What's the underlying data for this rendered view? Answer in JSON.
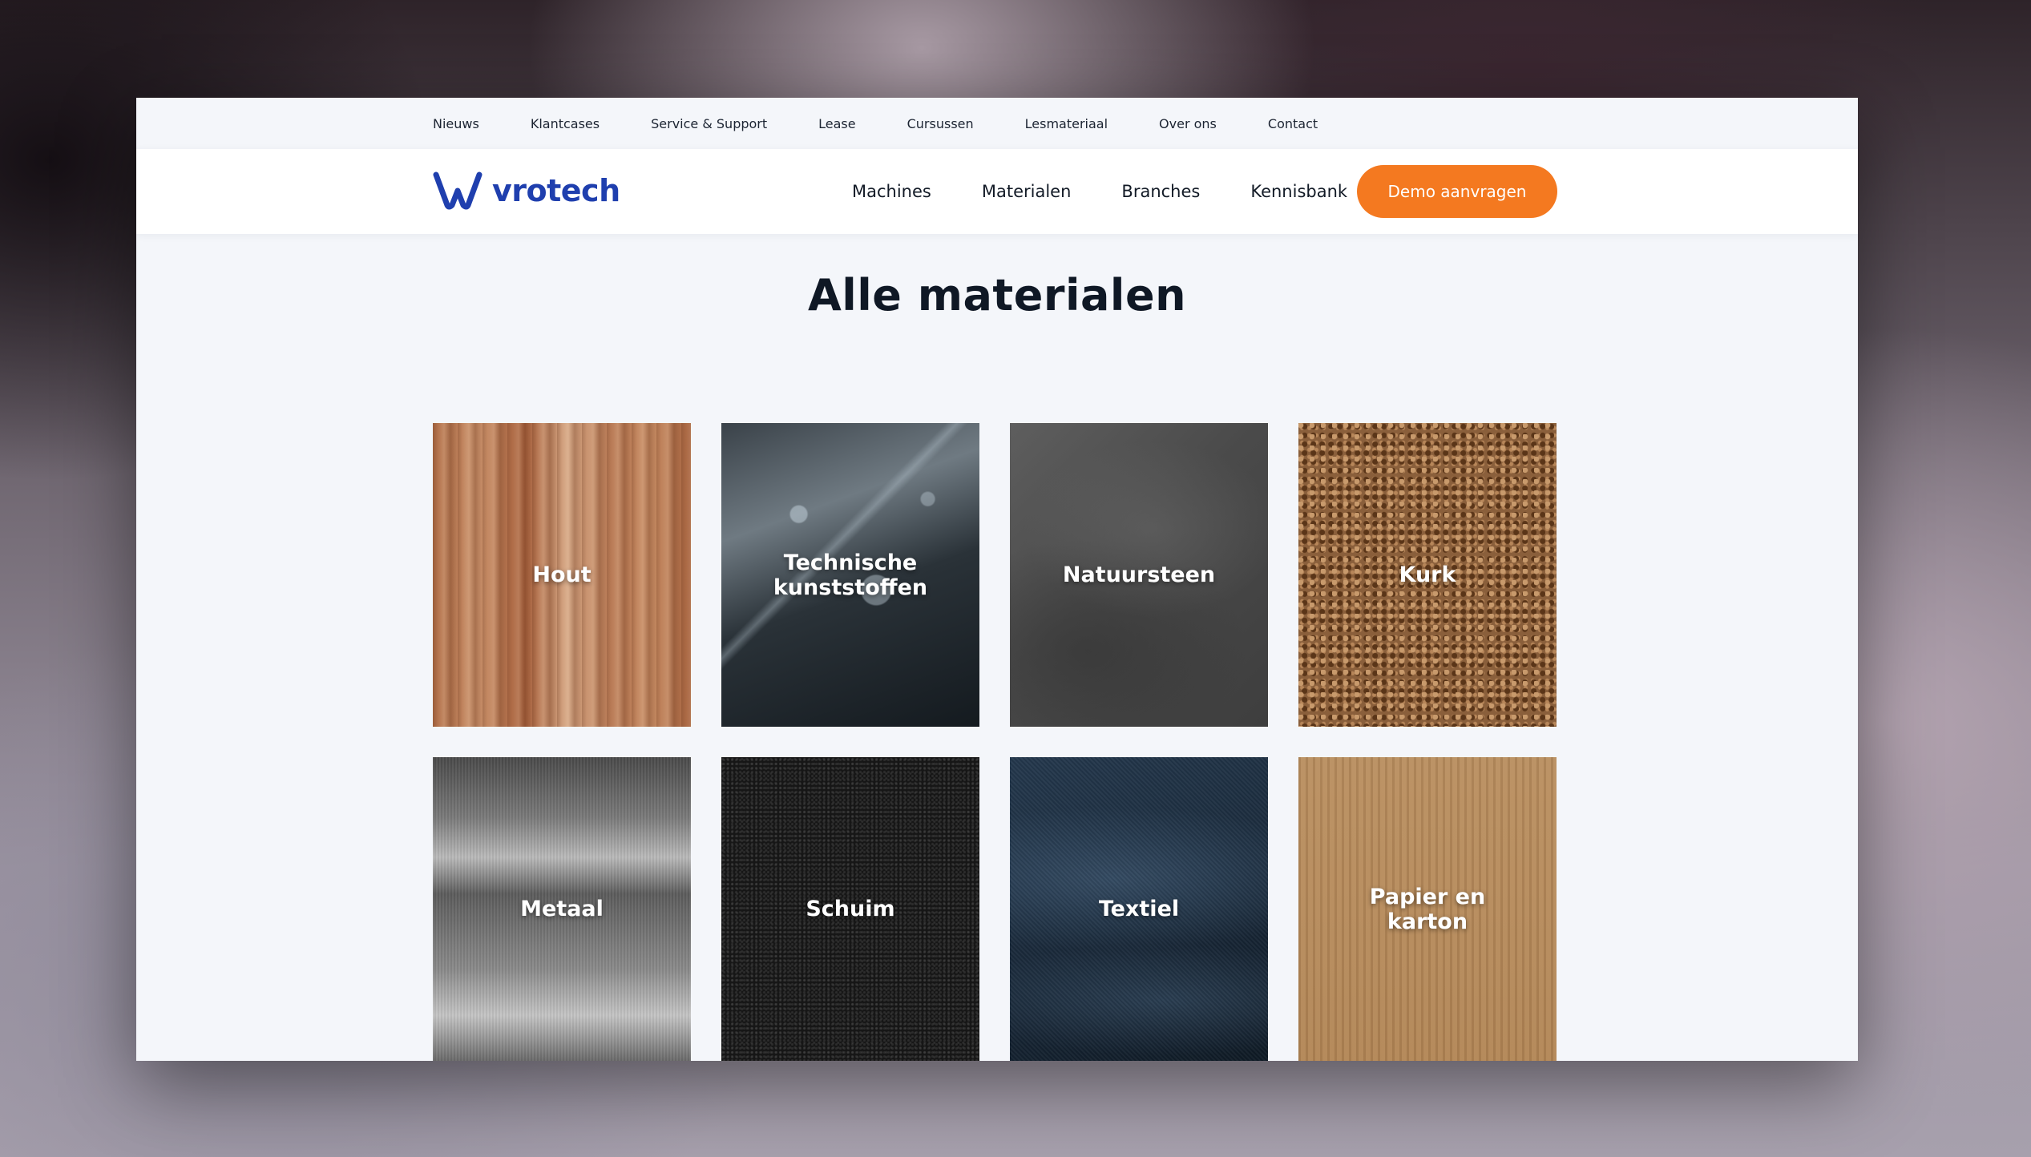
{
  "topbar": {
    "links": [
      "Nieuws",
      "Klantcases",
      "Service & Support",
      "Lease",
      "Cursussen",
      "Lesmateriaal",
      "Over ons",
      "Contact"
    ]
  },
  "header": {
    "logo_text": "vrotech",
    "nav": [
      "Machines",
      "Materialen",
      "Branches",
      "Kennisbank"
    ],
    "cta_label": "Demo aanvragen"
  },
  "main": {
    "title": "Alle materialen",
    "materials": [
      {
        "label": "Hout",
        "texture": "wood"
      },
      {
        "label": "Technische kunststoffen",
        "texture": "acrylic"
      },
      {
        "label": "Natuursteen",
        "texture": "slate"
      },
      {
        "label": "Kurk",
        "texture": "cork"
      },
      {
        "label": "Metaal",
        "texture": "brushed-metal"
      },
      {
        "label": "Schuim",
        "texture": "foam"
      },
      {
        "label": "Textiel",
        "texture": "fabric"
      },
      {
        "label": "Papier en karton",
        "texture": "cardboard"
      }
    ]
  },
  "colors": {
    "brand_blue": "#1f3fae",
    "cta_orange": "#f47920",
    "page_bg": "#f4f6fa"
  }
}
